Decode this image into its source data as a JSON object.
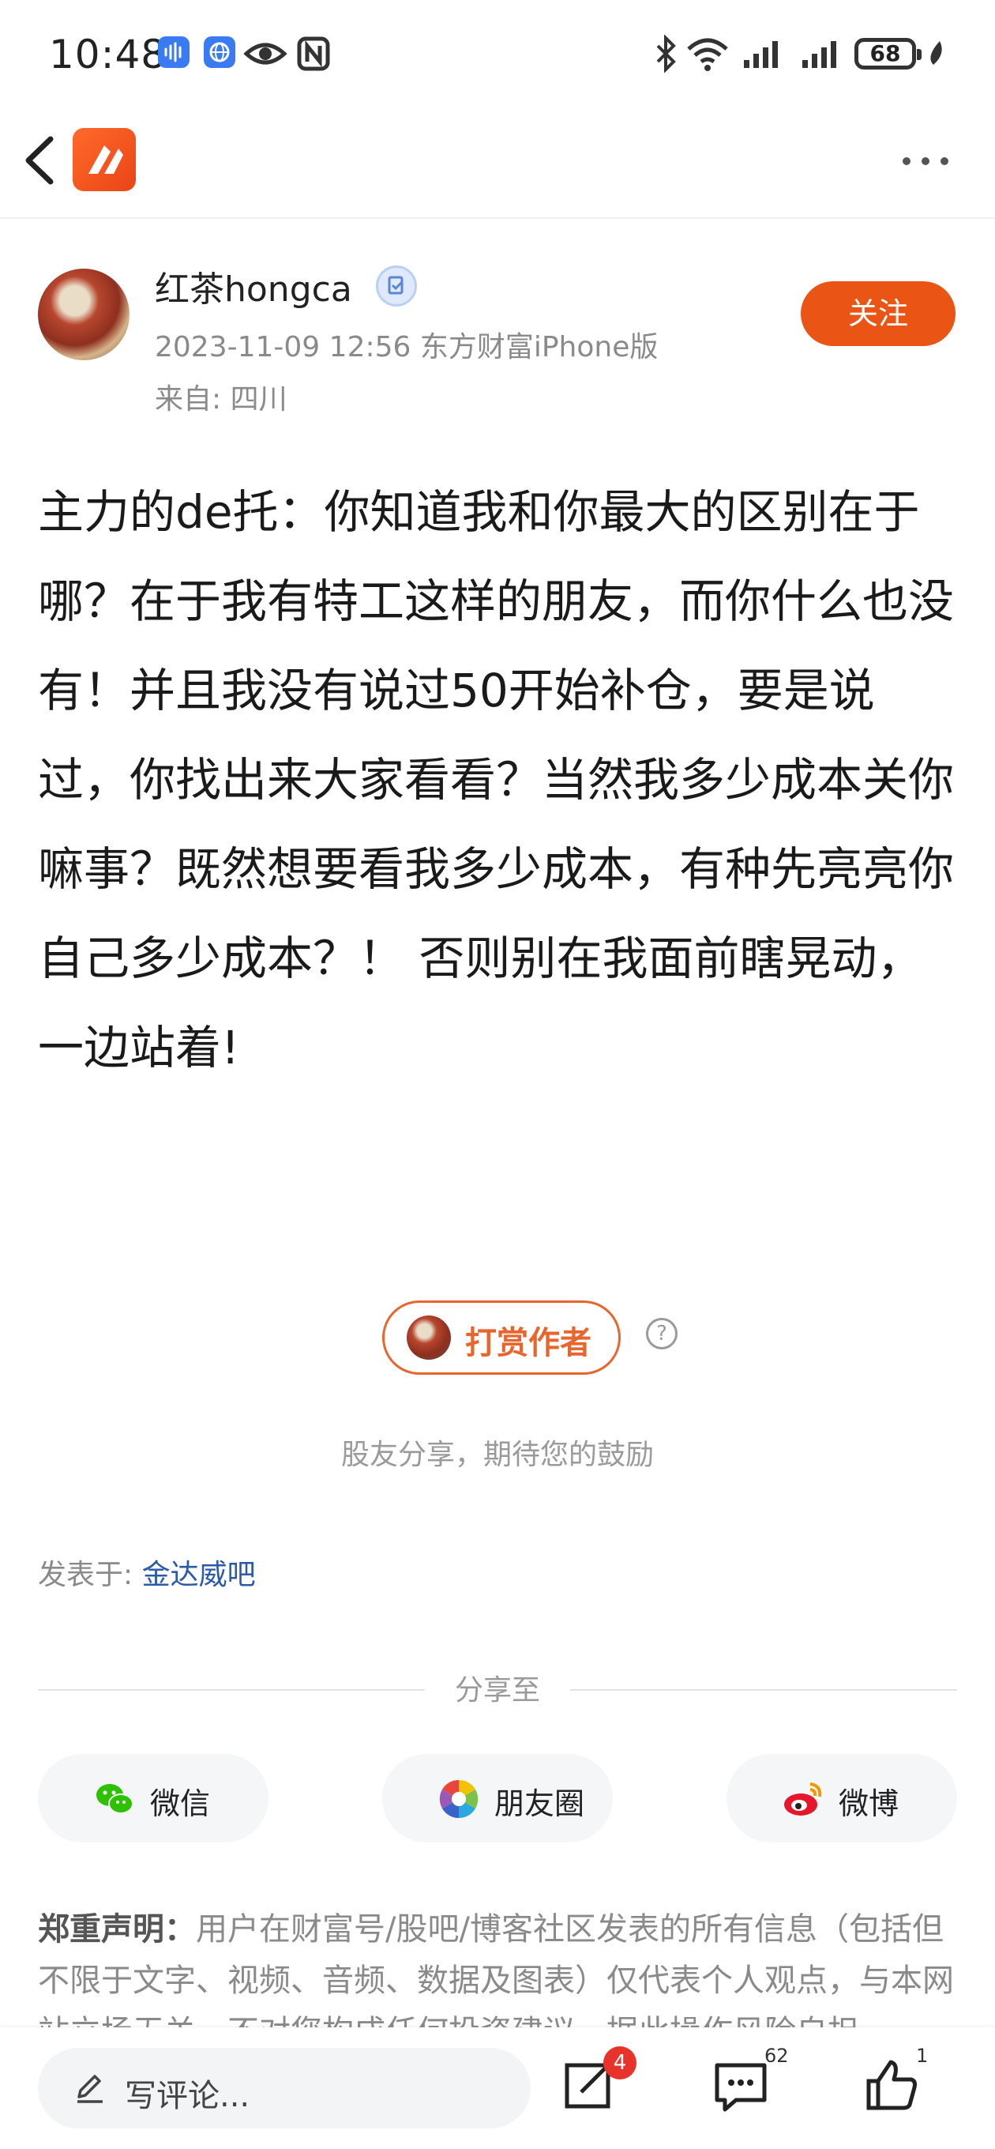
{
  "status_bar": {
    "time": "10:48",
    "battery": "68"
  },
  "post": {
    "author": {
      "name": "红茶hongca"
    },
    "meta": "2023-11-09 12:56 东方财富iPhone版",
    "location": "来自: 四川",
    "follow_label": "关注",
    "body": "主力的de托：你知道我和你最大的区别在于哪？在于我有特工这样的朋友，而你什么也没有！并且我没有说过50开始补仓，要是说过，你找出来大家看看？当然我多少成本关你嘛事？既然想要看我多少成本，有种先亮亮你自己多少成本？！ 否则别在我面前瞎晃动，一边站着!"
  },
  "reward": {
    "label": "打赏作者",
    "help": "?",
    "encourage": "股友分享，期待您的鼓励"
  },
  "posted_in": {
    "prefix": "发表于: ",
    "bar_name": "金达威吧"
  },
  "share": {
    "title": "分享至",
    "targets": [
      {
        "label": "微信",
        "icon": "wechat-icon"
      },
      {
        "label": "朋友圈",
        "icon": "moments-icon"
      },
      {
        "label": "微博",
        "icon": "weibo-icon"
      }
    ]
  },
  "disclaimer": {
    "title": "郑重声明：",
    "text": "用户在财富号/股吧/博客社区发表的所有信息（包括但不限于文字、视频、音频、数据及图表）仅代表个人观点，与本网站立场无关，不对您构成任何投资建议，据此操作风险自担。"
  },
  "bottom_bar": {
    "comment_placeholder": "写评论...",
    "share_badge": "4",
    "comment_count": "62",
    "like_count": "1"
  },
  "colors": {
    "accent": "#ea5414",
    "link": "#2b5aa8",
    "muted": "#8a8a8a"
  }
}
